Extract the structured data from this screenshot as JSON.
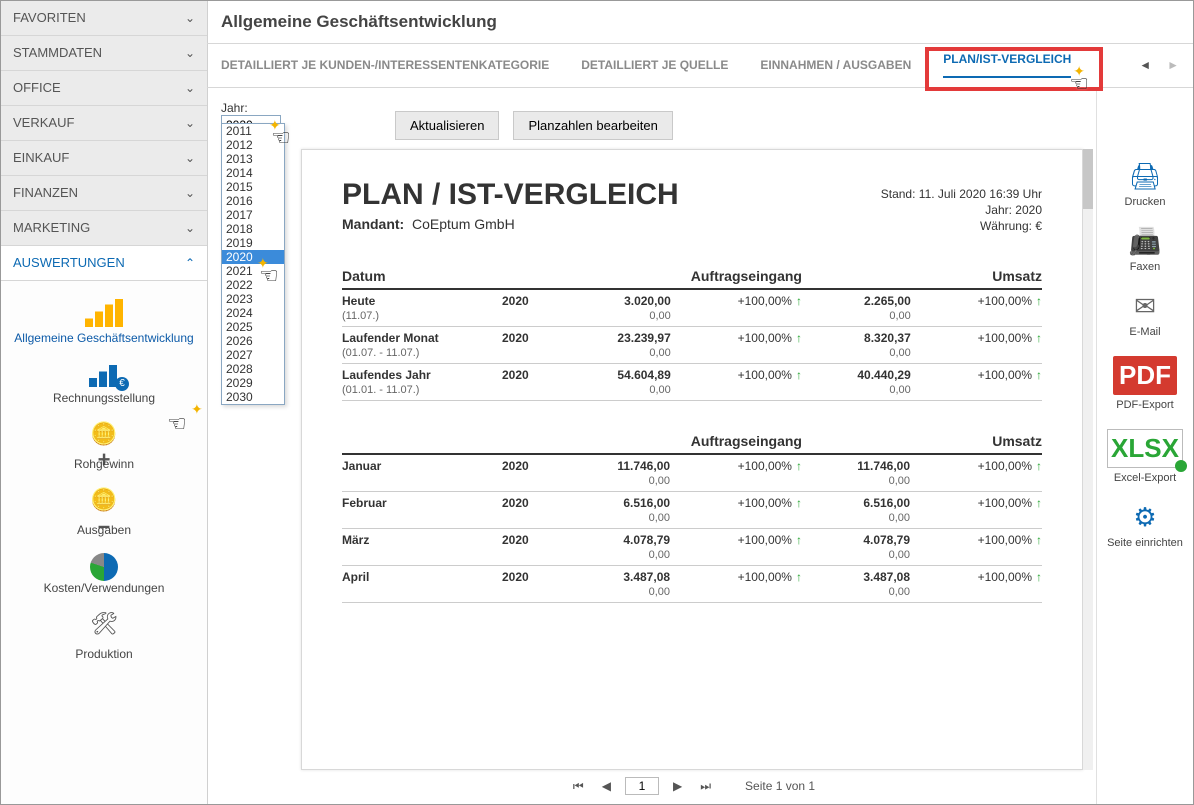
{
  "sidebar": {
    "groups": [
      "FAVORITEN",
      "STAMMDATEN",
      "OFFICE",
      "VERKAUF",
      "EINKAUF",
      "FINANZEN",
      "MARKETING",
      "AUSWERTUNGEN"
    ],
    "items": [
      {
        "label": "Allgemeine Geschäftsentwicklung"
      },
      {
        "label": "Rechnungsstellung"
      },
      {
        "label": "Rohgewinn"
      },
      {
        "label": "Ausgaben"
      },
      {
        "label": "Kosten/Verwendungen"
      },
      {
        "label": "Produktion"
      }
    ]
  },
  "header": {
    "title": "Allgemeine Geschäftsentwicklung"
  },
  "tabs": {
    "items": [
      "DETAILLIERT JE KUNDEN-/INTERESSENTENKATEGORIE",
      "DETAILLIERT JE QUELLE",
      "EINNAHMEN / AUSGABEN",
      "PLAN/IST-VERGLEICH"
    ],
    "activeIndex": 3
  },
  "toolbar": {
    "jahr_label": "Jahr:",
    "jahr_value": "2020",
    "aktualisieren": "Aktualisieren",
    "planzahlen": "Planzahlen bearbeiten",
    "years": [
      "2011",
      "2012",
      "2013",
      "2014",
      "2015",
      "2016",
      "2017",
      "2018",
      "2019",
      "2020",
      "2021",
      "2022",
      "2023",
      "2024",
      "2025",
      "2026",
      "2027",
      "2028",
      "2029",
      "2030"
    ],
    "selected_year": "2020"
  },
  "report": {
    "title": "PLAN / IST-VERGLEICH",
    "mandant_label": "Mandant:",
    "mandant": "CoEptum GmbH",
    "stand_label": "Stand:",
    "stand": "11. Juli 2020 16:39 Uhr",
    "jahr_label": "Jahr:",
    "jahr": "2020",
    "waehrung_label": "Währung:",
    "waehrung": "€",
    "col_datum": "Datum",
    "col_ae": "Auftragseingang",
    "col_umsatz": "Umsatz",
    "summary": [
      {
        "name": "Heute",
        "range": "(11.07.)",
        "year": "2020",
        "ae": "3.020,00",
        "ae_ref": "0,00",
        "ae_pct": "+100,00%",
        "um": "2.265,00",
        "um_ref": "0,00",
        "um_pct": "+100,00%"
      },
      {
        "name": "Laufender Monat",
        "range": "(01.07. - 11.07.)",
        "year": "2020",
        "ae": "23.239,97",
        "ae_ref": "0,00",
        "ae_pct": "+100,00%",
        "um": "8.320,37",
        "um_ref": "0,00",
        "um_pct": "+100,00%"
      },
      {
        "name": "Laufendes Jahr",
        "range": "(01.01. - 11.07.)",
        "year": "2020",
        "ae": "54.604,89",
        "ae_ref": "0,00",
        "ae_pct": "+100,00%",
        "um": "40.440,29",
        "um_ref": "0,00",
        "um_pct": "+100,00%"
      }
    ],
    "months": [
      {
        "name": "Januar",
        "year": "2020",
        "ae": "11.746,00",
        "ae_ref": "0,00",
        "ae_pct": "+100,00%",
        "um": "11.746,00",
        "um_ref": "0,00",
        "um_pct": "+100,00%"
      },
      {
        "name": "Februar",
        "year": "2020",
        "ae": "6.516,00",
        "ae_ref": "0,00",
        "ae_pct": "+100,00%",
        "um": "6.516,00",
        "um_ref": "0,00",
        "um_pct": "+100,00%"
      },
      {
        "name": "März",
        "year": "2020",
        "ae": "4.078,79",
        "ae_ref": "0,00",
        "ae_pct": "+100,00%",
        "um": "4.078,79",
        "um_ref": "0,00",
        "um_pct": "+100,00%"
      },
      {
        "name": "April",
        "year": "2020",
        "ae": "3.487,08",
        "ae_ref": "0,00",
        "ae_pct": "+100,00%",
        "um": "3.487,08",
        "um_ref": "0,00",
        "um_pct": "+100,00%"
      }
    ]
  },
  "pager": {
    "page": "1",
    "text": "Seite 1 von 1"
  },
  "actions": {
    "drucken": "Drucken",
    "faxen": "Faxen",
    "email": "E-Mail",
    "pdf": "PDF-Export",
    "excel": "Excel-Export",
    "seite": "Seite einrichten"
  }
}
